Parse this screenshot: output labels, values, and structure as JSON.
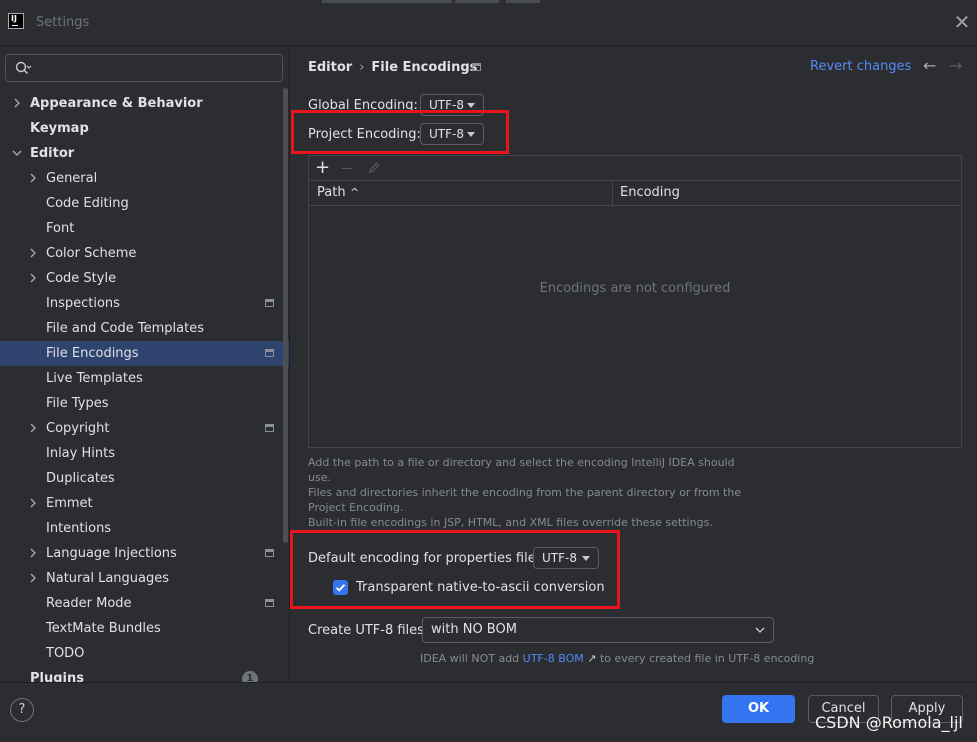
{
  "window": {
    "title": "Settings",
    "logo_text": "IJ"
  },
  "sidebar": {
    "search": {
      "value": "",
      "placeholder": ""
    },
    "items": [
      {
        "label": "Appearance & Behavior",
        "bold": true,
        "chevron": "right",
        "indent": 0
      },
      {
        "label": "Keymap",
        "bold": true,
        "chevron": "none",
        "indent": 0
      },
      {
        "label": "Editor",
        "bold": true,
        "chevron": "down",
        "indent": 0
      },
      {
        "label": "General",
        "chevron": "right",
        "indent": 1
      },
      {
        "label": "Code Editing",
        "chevron": "none",
        "indent": 1
      },
      {
        "label": "Font",
        "chevron": "none",
        "indent": 1
      },
      {
        "label": "Color Scheme",
        "chevron": "right",
        "indent": 1
      },
      {
        "label": "Code Style",
        "chevron": "right",
        "indent": 1
      },
      {
        "label": "Inspections",
        "chevron": "none",
        "indent": 1,
        "pin": true
      },
      {
        "label": "File and Code Templates",
        "chevron": "none",
        "indent": 1
      },
      {
        "label": "File Encodings",
        "chevron": "none",
        "indent": 1,
        "pin": true,
        "selected": true
      },
      {
        "label": "Live Templates",
        "chevron": "none",
        "indent": 1
      },
      {
        "label": "File Types",
        "chevron": "none",
        "indent": 1
      },
      {
        "label": "Copyright",
        "chevron": "right",
        "indent": 1,
        "pin": true
      },
      {
        "label": "Inlay Hints",
        "chevron": "none",
        "indent": 1
      },
      {
        "label": "Duplicates",
        "chevron": "none",
        "indent": 1
      },
      {
        "label": "Emmet",
        "chevron": "right",
        "indent": 1
      },
      {
        "label": "Intentions",
        "chevron": "none",
        "indent": 1
      },
      {
        "label": "Language Injections",
        "chevron": "right",
        "indent": 1,
        "pin": true
      },
      {
        "label": "Natural Languages",
        "chevron": "right",
        "indent": 1
      },
      {
        "label": "Reader Mode",
        "chevron": "none",
        "indent": 1,
        "pin": true
      },
      {
        "label": "TextMate Bundles",
        "chevron": "none",
        "indent": 1
      },
      {
        "label": "TODO",
        "chevron": "none",
        "indent": 1
      },
      {
        "label": "Plugins",
        "bold": true,
        "chevron": "none",
        "indent": 0
      }
    ],
    "plugins_badge": "1"
  },
  "main": {
    "breadcrumb": {
      "parent": "Editor",
      "separator": "›",
      "current": "File Encodings"
    },
    "revert_label": "Revert changes",
    "global_encoding": {
      "label": "Global Encoding:",
      "value": "UTF-8"
    },
    "project_encoding": {
      "label": "Project Encoding:",
      "value": "UTF-8"
    },
    "table": {
      "toolbar": {
        "add": "+",
        "remove": "—"
      },
      "columns": [
        "Path",
        "Encoding"
      ],
      "sort_indicator": "^",
      "empty_text": "Encodings are not configured"
    },
    "help_lines": [
      "Add the path to a file or directory and select the encoding IntelliJ IDEA should",
      "use.",
      "Files and directories inherit the encoding from the parent directory or from the",
      "Project Encoding.",
      "Built-in file encodings in JSP, HTML, and XML files override these settings."
    ],
    "properties_encoding": {
      "label": "Default encoding for properties files:",
      "value": "UTF-8"
    },
    "transparent_conversion": {
      "label": "Transparent native-to-ascii conversion",
      "checked": true
    },
    "create_utf8": {
      "label": "Create UTF-8 files:",
      "value": "with NO BOM"
    },
    "bom_note": {
      "prefix": "IDEA will NOT add",
      "link": "UTF-8 BOM",
      "link_arrow": "↗",
      "suffix": "to every created file in UTF-8 encoding"
    }
  },
  "footer": {
    "help": "?",
    "ok_label": "OK",
    "cancel_label": "Cancel",
    "apply_label": "Apply"
  },
  "watermark": "CSDN @Romola_ljl",
  "colors": {
    "accent": "#3574f0",
    "link": "#548af7",
    "highlight_box": "#e8141b",
    "selection": "#2e436e"
  }
}
